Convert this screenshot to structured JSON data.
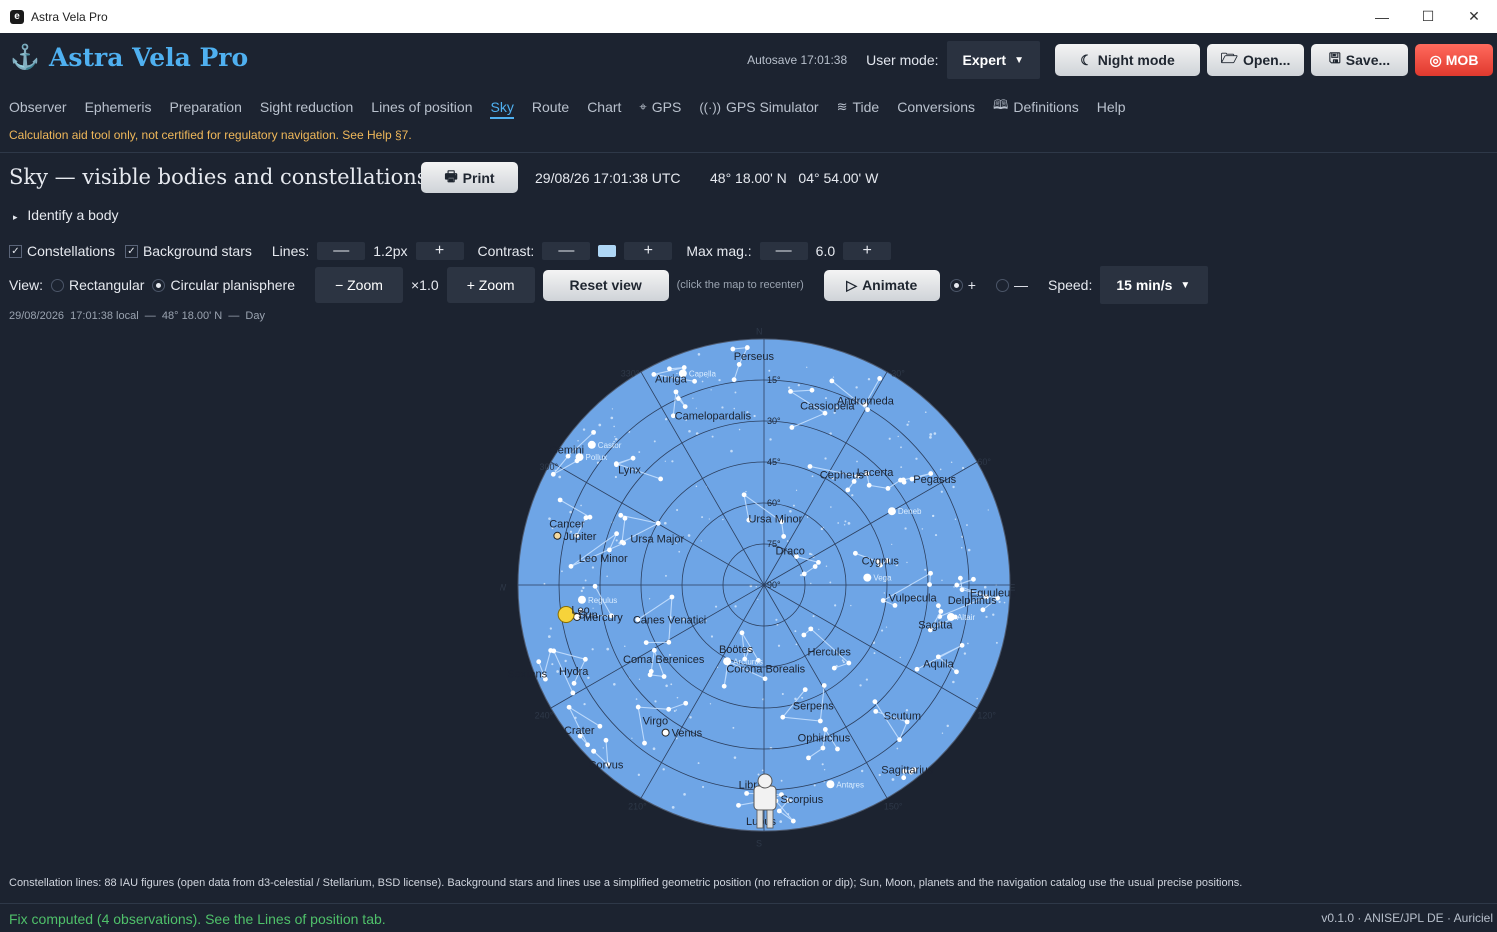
{
  "window": {
    "title": "Astra Vela Pro",
    "min": "—",
    "max": "☐",
    "close": "✕"
  },
  "brand": {
    "name": "Astra Vela Pro",
    "icon": "anchor-icon",
    "color": "#4fb0f0"
  },
  "topbar": {
    "autosave": "Autosave 17:01:38",
    "user_mode_label": "User mode:",
    "user_mode_value": "Expert",
    "night_mode": "Night mode",
    "open": "Open...",
    "save": "Save...",
    "mob": "MOB"
  },
  "nav": {
    "tabs": [
      {
        "label": "Observer",
        "icon": ""
      },
      {
        "label": "Ephemeris",
        "icon": ""
      },
      {
        "label": "Preparation",
        "icon": ""
      },
      {
        "label": "Sight reduction",
        "icon": ""
      },
      {
        "label": "Lines of position",
        "icon": ""
      },
      {
        "label": "Sky",
        "icon": "",
        "active": true
      },
      {
        "label": "Route",
        "icon": ""
      },
      {
        "label": "Chart",
        "icon": ""
      },
      {
        "label": "GPS",
        "icon": "gps-icon"
      },
      {
        "label": "GPS Simulator",
        "icon": "broadcast-icon"
      },
      {
        "label": "Tide",
        "icon": "wave-icon"
      },
      {
        "label": "Conversions",
        "icon": ""
      },
      {
        "label": "Definitions",
        "icon": "book-icon"
      },
      {
        "label": "Help",
        "icon": ""
      }
    ]
  },
  "disclaimer": "Calculation aid tool only, not certified for regulatory navigation. See Help §7.",
  "sky": {
    "title": "Sky — visible bodies and constellations",
    "print": "Print",
    "datetime": "29/08/26 17:01:38 UTC",
    "position": "48° 18.00' N   04° 54.00' W",
    "identify": "Identify a body",
    "constellations_label": "Constellations",
    "constellations_checked": true,
    "background_stars_label": "Background stars",
    "background_stars_checked": true,
    "lines_label": "Lines:",
    "lines_value": "1.2px",
    "contrast_label": "Contrast:",
    "contrast_color": "#aed6f5",
    "maxmag_label": "Max mag.:",
    "maxmag_value": "6.0",
    "minus": "—",
    "plus": "+",
    "view_label": "View:",
    "view_rect": "Rectangular",
    "view_circ": "Circular planisphere",
    "view_selected": "Circular planisphere",
    "zoom_out": "− Zoom",
    "zoom_value": "×1.0",
    "zoom_in": "+ Zoom",
    "reset_view": "Reset view",
    "recenter_hint": "(click the map to recenter)",
    "animate": "Animate",
    "dir_plus": "+",
    "dir_minus": "—",
    "dir_selected": "+",
    "speed_label": "Speed:",
    "speed_value": "15 min/s",
    "local_line": "29/08/2026  17:01:38 local  —  48° 18.00' N  —  Day",
    "sky_color": "#6ea5e6",
    "constellations": [
      {
        "name": "Perseus"
      },
      {
        "name": "Auriga"
      },
      {
        "name": "Cassiopeia"
      },
      {
        "name": "Andromeda"
      },
      {
        "name": "Camelopardalis"
      },
      {
        "name": "Gemini"
      },
      {
        "name": "Lynx"
      },
      {
        "name": "Cepheus"
      },
      {
        "name": "Lacerta"
      },
      {
        "name": "Pegasus"
      },
      {
        "name": "Ursa Minor"
      },
      {
        "name": "Cancer"
      },
      {
        "name": "Ursa Major"
      },
      {
        "name": "Draco"
      },
      {
        "name": "Cygnus"
      },
      {
        "name": "Leo Minor"
      },
      {
        "name": "Equuleus"
      },
      {
        "name": "Delphinus"
      },
      {
        "name": "Vulpecula"
      },
      {
        "name": "Leo"
      },
      {
        "name": "Canes Venatici"
      },
      {
        "name": "Sagitta"
      },
      {
        "name": "Hercules"
      },
      {
        "name": "Aquila"
      },
      {
        "name": "Sextans"
      },
      {
        "name": "Hydra"
      },
      {
        "name": "Coma Berenices"
      },
      {
        "name": "Boötes"
      },
      {
        "name": "Corona Borealis"
      },
      {
        "name": "Serpens"
      },
      {
        "name": "Scutum"
      },
      {
        "name": "Virgo"
      },
      {
        "name": "Crater"
      },
      {
        "name": "Ophiuchus"
      },
      {
        "name": "Corvus"
      },
      {
        "name": "Sagittarius"
      },
      {
        "name": "Libra"
      },
      {
        "name": "Scorpius"
      },
      {
        "name": "Lupus"
      }
    ],
    "named_stars": [
      "Capella",
      "Castor",
      "Pollux",
      "Deneb",
      "Vega",
      "Altair",
      "Regulus",
      "Arcturus",
      "Antares"
    ],
    "planets": [
      "Jupiter",
      "Mercury",
      "Sun",
      "Venus"
    ],
    "alt_rings": [
      "90°",
      "75°",
      "60°",
      "45°",
      "30°",
      "15°"
    ],
    "az_labels": [
      "330°",
      "300°",
      "240°",
      "210°",
      "150°",
      "120°",
      "60°",
      "30°",
      "N",
      "S",
      "E",
      "W"
    ]
  },
  "footnote": "Constellation lines: 88 IAU figures (open data from d3-celestial / Stellarium, BSD license). Background stars and lines use a simplified geometric position (no refraction or dip); Sun, Moon, planets and the navigation catalog use the usual precise positions.",
  "status": {
    "fix": "Fix computed (4 observations). See the Lines of position tab.",
    "version": "v0.1.0 · ANISE/JPL DE · Auriciel"
  }
}
